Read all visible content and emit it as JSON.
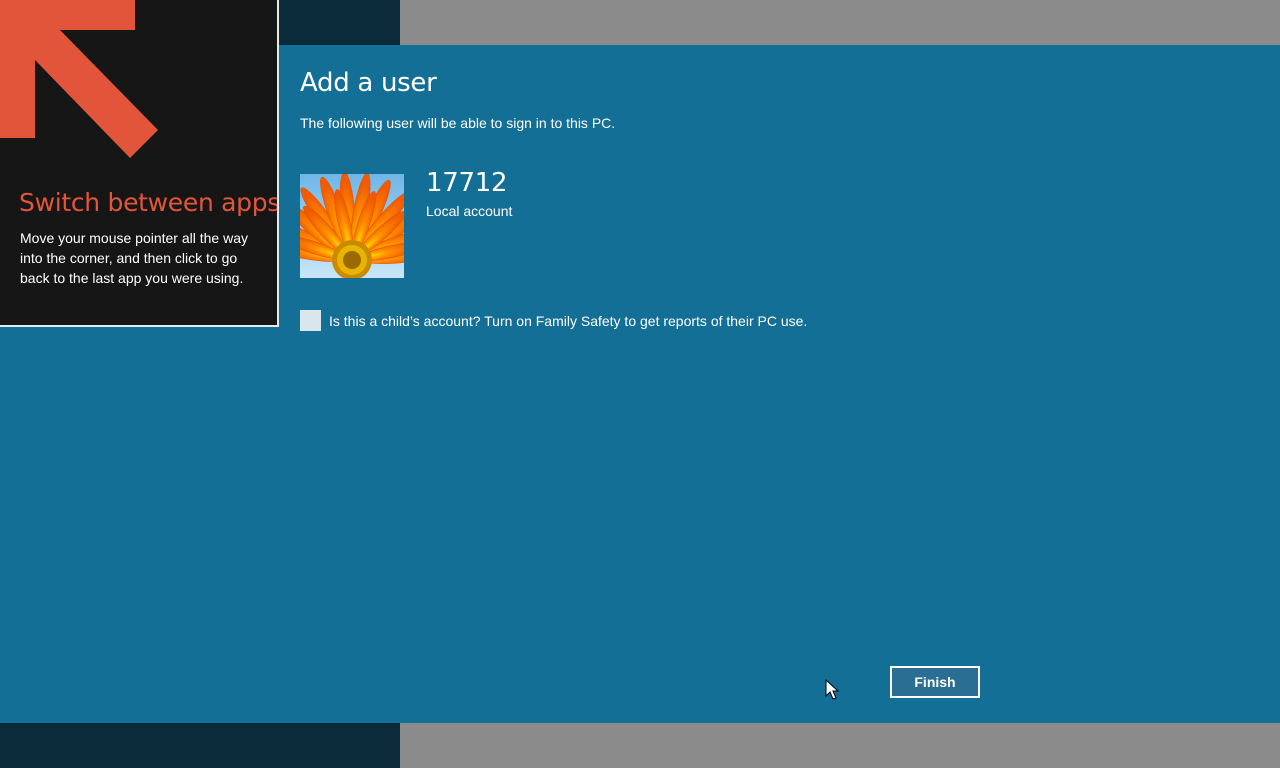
{
  "tip": {
    "title": "Switch between apps",
    "body": "Move your mouse pointer all the way into the corner, and then click to go back to the last app you were using.",
    "arrow_color": "#e2553a",
    "panel_color": "#161616"
  },
  "dialog": {
    "title": "Add a user",
    "subtitle": "The following user will be able to sign in to this PC.",
    "background_color": "#136f96",
    "user": {
      "name": "17712",
      "account_type": "Local account",
      "avatar": "orange-gerbera-flower-picture"
    },
    "child_account": {
      "label": "Is this a child’s account? Turn on Family Safety to get reports of their PC use.",
      "checked": false
    },
    "finish_label": "Finish"
  }
}
